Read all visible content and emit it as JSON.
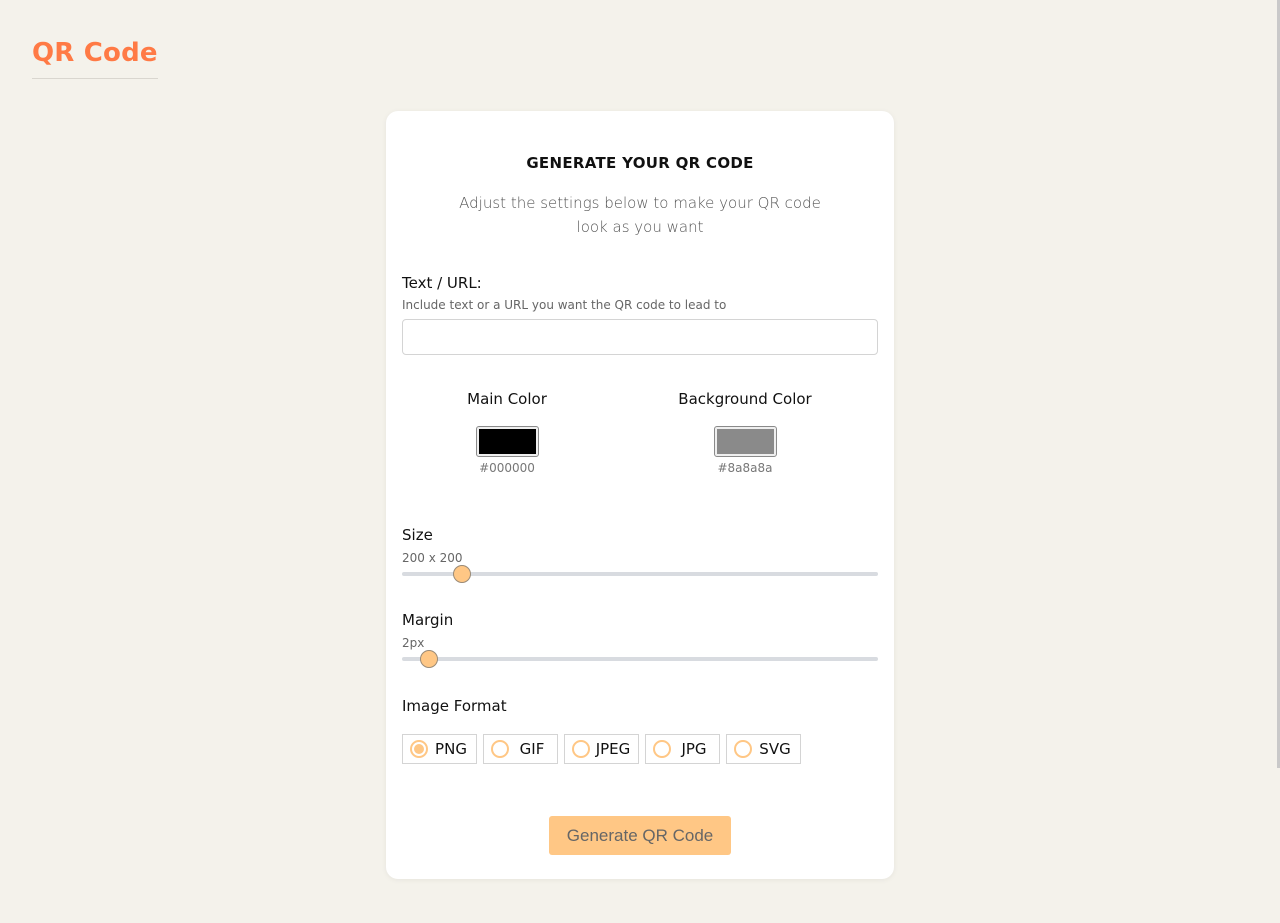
{
  "colors": {
    "brand": "#ff7a45",
    "accent": "#ffc785",
    "button_bg": "#ffc785",
    "main_color": "#000000",
    "background_color": "#8a8a8a"
  },
  "brand": {
    "title": "QR Code"
  },
  "card": {
    "title": "GENERATE YOUR QR CODE",
    "subtitle": "Adjust the settings below to make your QR code look as you want"
  },
  "text_input": {
    "label": "Text / URL:",
    "hint": "Include text or a URL you want the QR code to lead to",
    "value": "",
    "placeholder": ""
  },
  "colors_section": {
    "main": {
      "label": "Main Color",
      "hex": "#000000"
    },
    "background": {
      "label": "Background Color",
      "hex": "#8a8a8a"
    }
  },
  "size": {
    "label": "Size",
    "value_text": "200 x 200",
    "level_fraction": 0.125
  },
  "margin": {
    "label": "Margin",
    "value_text": "2px",
    "level_fraction": 0.057
  },
  "image_format": {
    "label": "Image Format",
    "selected": "PNG",
    "options": [
      {
        "label": "PNG"
      },
      {
        "label": "GIF"
      },
      {
        "label": "JPEG"
      },
      {
        "label": "JPG"
      },
      {
        "label": "SVG"
      }
    ]
  },
  "generate": {
    "label": "Generate QR Code"
  }
}
